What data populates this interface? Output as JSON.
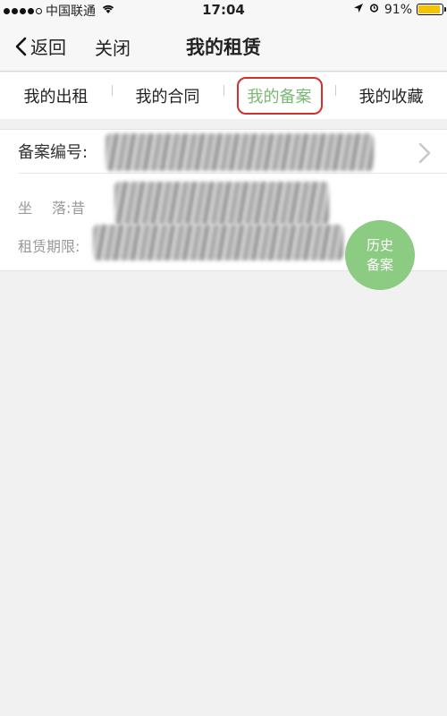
{
  "status_bar": {
    "carrier": "中国联通",
    "time": "17:04",
    "battery": "91%",
    "battery_level": 0.91
  },
  "nav": {
    "back_label": "返回",
    "close_label": "关闭",
    "title": "我的租赁"
  },
  "tabs": [
    {
      "label": "我的出租",
      "active": false
    },
    {
      "label": "我的合同",
      "active": false
    },
    {
      "label": "我的备案",
      "active": true
    },
    {
      "label": "我的收藏",
      "active": false
    }
  ],
  "record": {
    "number_label": "备案编号:",
    "location_label_a": "坐",
    "location_label_b": "落:",
    "location_value_visible": "昔",
    "period_label": "租赁期限:"
  },
  "fab": {
    "line1": "历史",
    "line2": "备案"
  },
  "colors": {
    "active_tab": "#7ab873",
    "highlight_ring": "#d0302e",
    "fab": "#8ccb82",
    "battery": "#f2c300"
  }
}
